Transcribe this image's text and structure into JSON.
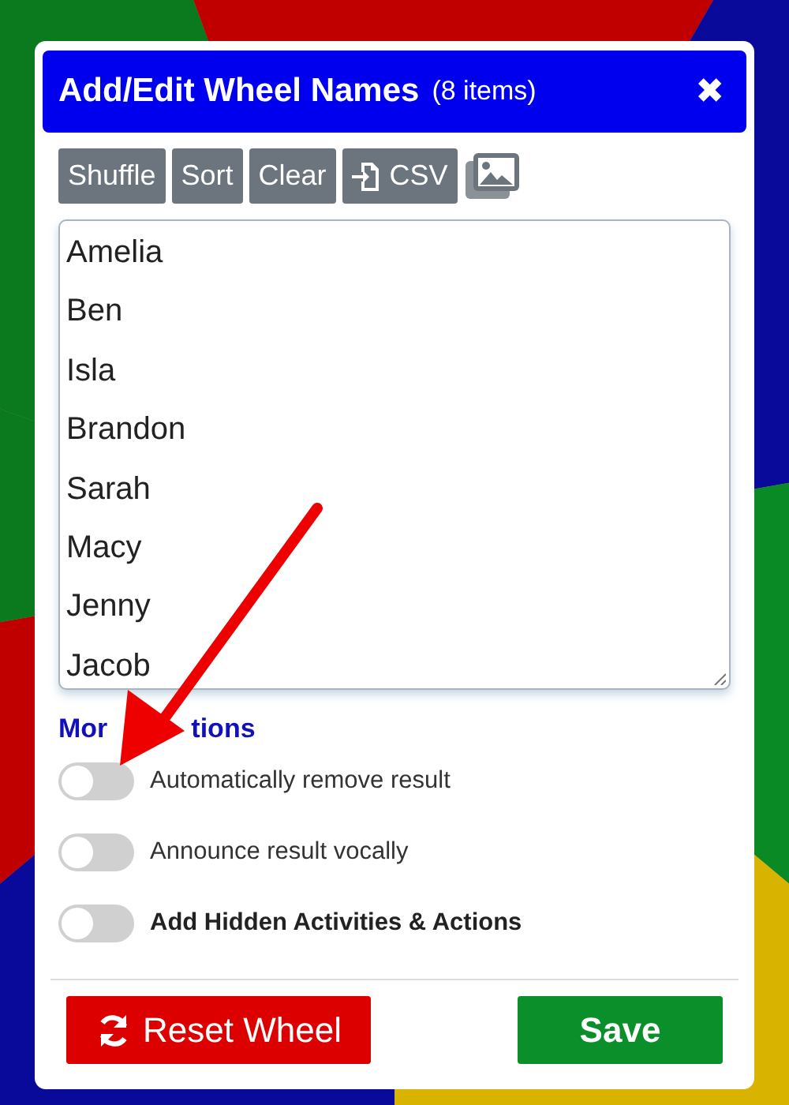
{
  "dialog": {
    "title": "Add/Edit Wheel Names",
    "count": "(8 items)",
    "close": "✖"
  },
  "toolbar": [
    {
      "kind": "text",
      "label": "Shuffle"
    },
    {
      "kind": "text",
      "label": "Sort"
    },
    {
      "kind": "text",
      "label": "Clear"
    },
    {
      "kind": "import",
      "label": "CSV"
    },
    {
      "kind": "image"
    }
  ],
  "names": [
    "Amelia",
    "Ben",
    "Isla",
    "Brandon",
    "Sarah",
    "Macy",
    "Jenny",
    "Jacob"
  ],
  "more_options": {
    "heading_parts": [
      "Mor",
      "tions"
    ],
    "options": [
      {
        "label": "Automatically remove result",
        "on": false,
        "bold": false
      },
      {
        "label": "Announce result vocally",
        "on": false,
        "bold": false
      },
      {
        "label": "Add Hidden Activities & Actions",
        "on": false,
        "bold": true
      }
    ]
  },
  "footer": {
    "reset": "Reset Wheel",
    "save": "Save"
  }
}
